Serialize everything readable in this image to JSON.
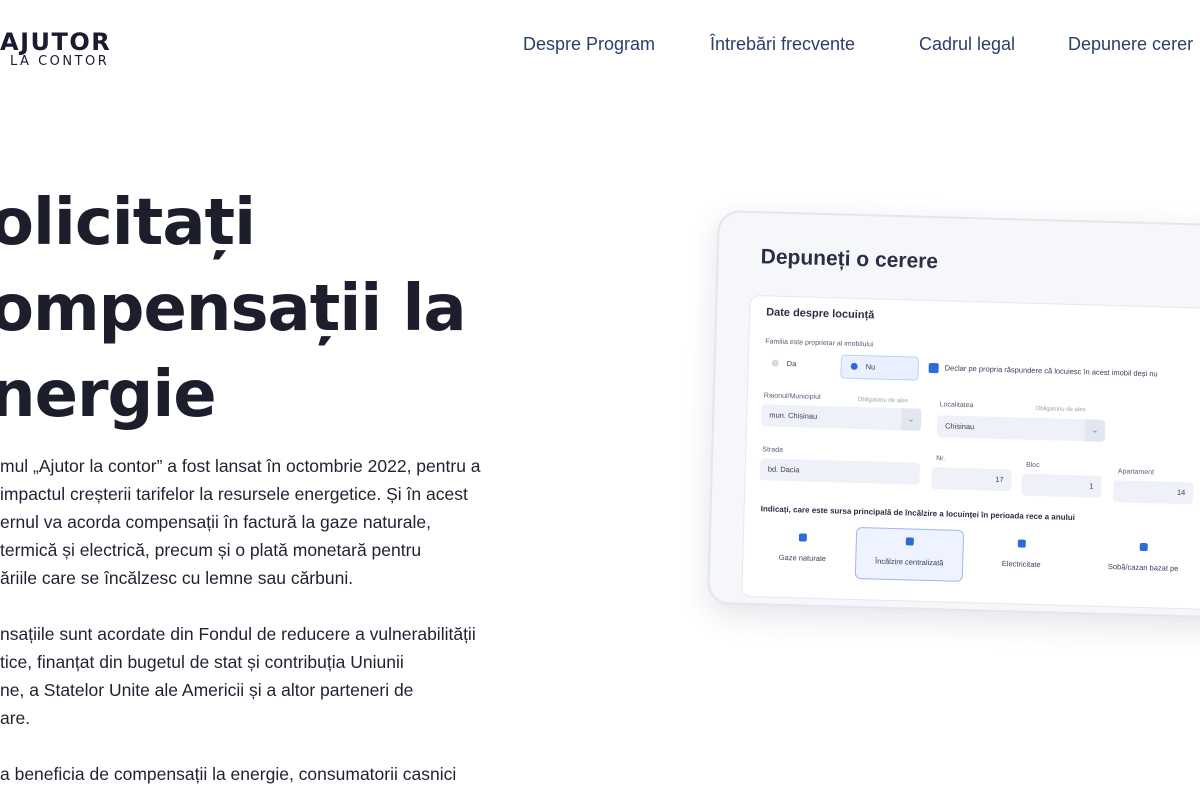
{
  "header": {
    "logo_main": "AJUTOR",
    "logo_sub": "LA CONTOR",
    "nav": [
      {
        "label": "Despre Program"
      },
      {
        "label": "Întrebări frecvente"
      },
      {
        "label": "Cadrul legal"
      },
      {
        "label": "Depunere cerer"
      }
    ]
  },
  "hero": {
    "title_lines": [
      "olicitați",
      "ompensații la",
      "nergie"
    ],
    "paragraph1": [
      "mul „Ajutor la contor” a fost lansat în octombrie 2022, pentru a",
      " impactul creșterii tarifelor la resursele energetice. Și în acest",
      "ernul va acorda compensații în factură la gaze naturale,",
      " termică și electrică, precum și o plată monetară pentru",
      "ăriile care se încălzesc cu lemne sau cărbuni."
    ],
    "paragraph2": [
      "nsațiile sunt acordate din Fondul de reducere a vulnerabilității",
      "tice, finanțat din bugetul de stat și contribuția Uniunii",
      "ne, a Statelor Unite ale Americii și a altor parteneri de",
      "are."
    ],
    "paragraph3": [
      "a beneficia de compensații la energie, consumatorii casnici"
    ]
  },
  "mockup": {
    "title": "Depuneți o cerere",
    "section_title": "Date despre locuință",
    "owner_question": "Familia este proprietar al imobilului",
    "owner_options": [
      {
        "label": "Da",
        "selected": false
      },
      {
        "label": "Nu",
        "selected": true
      }
    ],
    "declaration": "Declar pe propria răspundere că locuiesc în acest imobil deși nu",
    "raion_label": "Raionul/Municipiul",
    "raion_hint": "Obligatoriu de ales",
    "raion_value": "mun. Chisinau",
    "localitate_label": "Localitatea",
    "localitate_hint": "Obligatoriu de ales",
    "localitate_value": "Chisinau",
    "strada_label": "Strada",
    "strada_value": "bd. Dacia",
    "nr_label": "Nr.",
    "nr_value": "17",
    "bloc_label": "Bloc",
    "bloc_value": "1",
    "apartament_label": "Apartament",
    "apartament_value": "14",
    "heating_question": "Indicați, care este sursa principală de încălzire a locuinței în perioada rece a anului",
    "heating_options": [
      {
        "label": "Gaze naturale",
        "selected": false
      },
      {
        "label": "Încălzire centralizată",
        "selected": true
      },
      {
        "label": "Electricitate",
        "selected": false
      },
      {
        "label": "Sobă/cazan bazat pe",
        "selected": false
      }
    ]
  }
}
